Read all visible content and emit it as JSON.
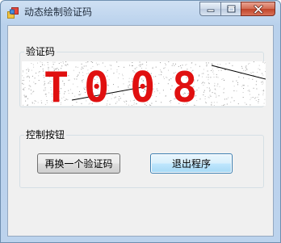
{
  "window": {
    "title": "动态绘制验证码"
  },
  "caption_buttons": {
    "minimize_icon": "minimize-icon",
    "maximize_icon": "maximize-icon",
    "close_icon": "close-icon"
  },
  "captcha_group": {
    "label": "验证码",
    "code": "T008",
    "chars": [
      "T",
      "0",
      "0",
      "8"
    ],
    "char_color": "#e01010"
  },
  "controls_group": {
    "label": "控制按钮",
    "change_button_label": "再换一个验证码",
    "exit_button_label": "退出程序"
  },
  "colors": {
    "titlebar": "#b9d1ec",
    "client_bg": "#f0f0f0",
    "captcha_text": "#e01010",
    "close_button": "#c0442a"
  }
}
